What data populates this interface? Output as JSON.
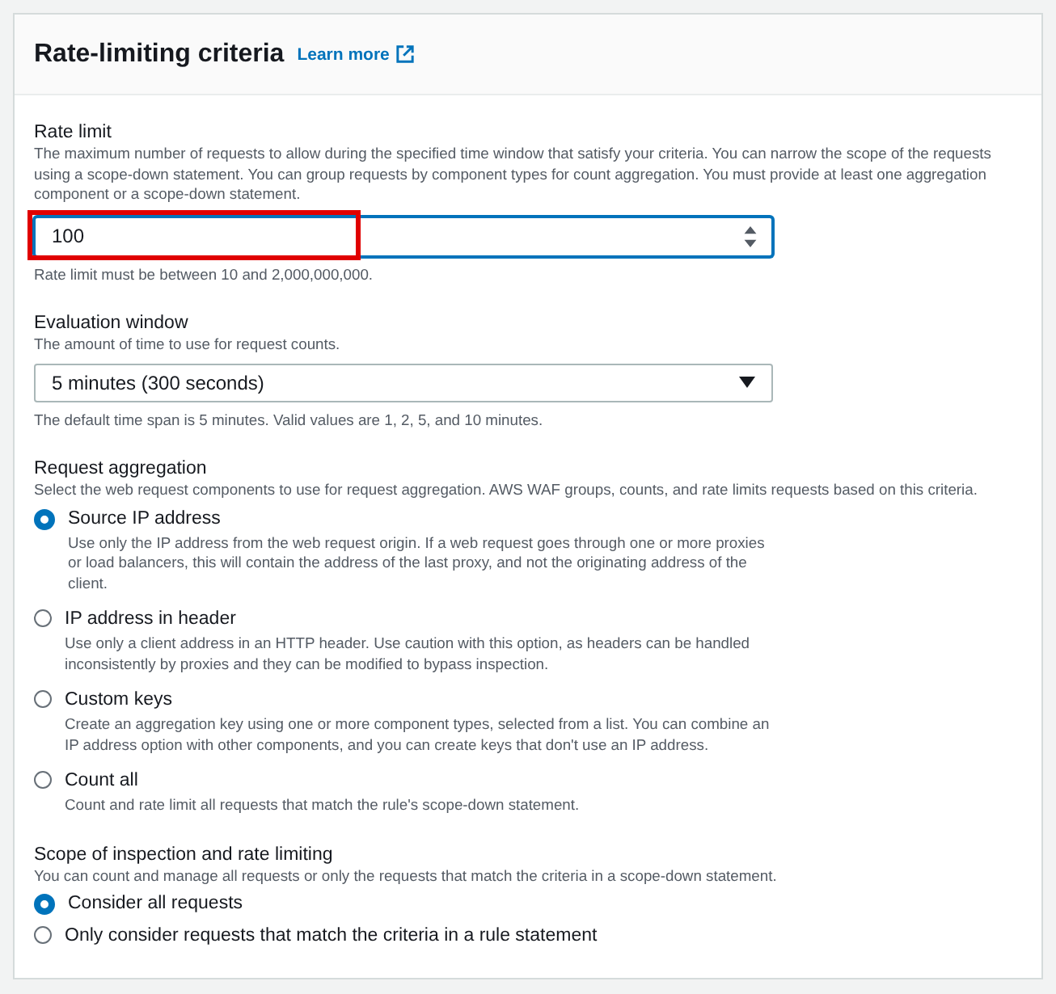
{
  "panel": {
    "title": "Rate-limiting criteria",
    "learn_more": "Learn more"
  },
  "rate_limit": {
    "label": "Rate limit",
    "description": "The maximum number of requests to allow during the specified time window that satisfy your criteria. You can narrow the scope of the requests using a scope-down statement. You can group requests by component types for count aggregation. You must provide at least one aggregation component or a scope-down statement.",
    "value": "100",
    "highlighted": true,
    "constraint": "Rate limit must be between 10 and 2,000,000,000."
  },
  "evaluation_window": {
    "label": "Evaluation window",
    "description": "The amount of time to use for request counts.",
    "value": "5 minutes (300 seconds)",
    "constraint": "The default time span is 5 minutes. Valid values are 1, 2, 5, and 10 minutes."
  },
  "request_aggregation": {
    "label": "Request aggregation",
    "description": "Select the web request components to use for request aggregation. AWS WAF groups, counts, and rate limits requests based on this criteria.",
    "options": [
      {
        "label": "Source IP address",
        "description": "Use only the IP address from the web request origin. If a web request goes through one or more proxies or load balancers, this will contain the address of the last proxy, and not the originating address of the client.",
        "selected": true
      },
      {
        "label": "IP address in header",
        "description": "Use only a client address in an HTTP header. Use caution with this option, as headers can be handled inconsistently by proxies and they can be modified to bypass inspection.",
        "selected": false
      },
      {
        "label": "Custom keys",
        "description": "Create an aggregation key using one or more component types, selected from a list. You can combine an IP address option with other components, and you can create keys that don't use an IP address.",
        "selected": false
      },
      {
        "label": "Count all",
        "description": "Count and rate limit all requests that match the rule's scope-down statement.",
        "selected": false
      }
    ]
  },
  "scope": {
    "label": "Scope of inspection and rate limiting",
    "description": "You can count and manage all requests or only the requests that match the criteria in a scope-down statement.",
    "options": [
      {
        "label": "Consider all requests",
        "selected": true
      },
      {
        "label": "Only consider requests that match the criteria in a rule statement",
        "selected": false
      }
    ]
  }
}
